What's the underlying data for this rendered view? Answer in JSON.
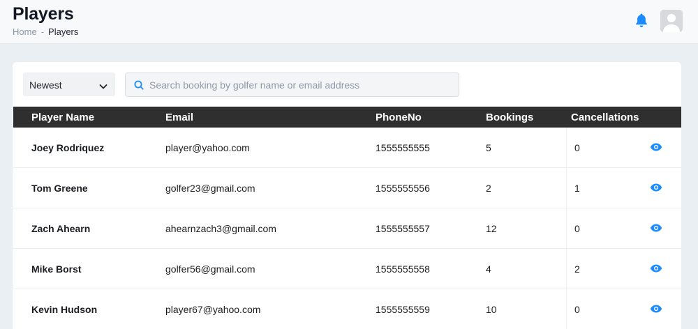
{
  "header": {
    "title": "Players",
    "breadcrumb": {
      "home": "Home",
      "separator": "-",
      "current": "Players"
    },
    "icons": [
      "bell-icon",
      "avatar"
    ]
  },
  "toolbar": {
    "sort_selected": "Newest",
    "search_placeholder": "Search booking by golfer name or email address",
    "search_value": ""
  },
  "table": {
    "columns": [
      "Player Name",
      "Email",
      "PhoneNo",
      "Bookings",
      "Cancellations"
    ],
    "rows": [
      {
        "name": "Joey Rodriquez",
        "email": "player@yahoo.com",
        "phone": "1555555555",
        "bookings": "5",
        "cancellations": "0"
      },
      {
        "name": "Tom Greene",
        "email": "golfer23@gmail.com",
        "phone": "1555555556",
        "bookings": "2",
        "cancellations": "1"
      },
      {
        "name": "Zach Ahearn",
        "email": "ahearnzach3@gmail.com",
        "phone": "1555555557",
        "bookings": "12",
        "cancellations": "0"
      },
      {
        "name": "Mike Borst",
        "email": "golfer56@gmail.com",
        "phone": "1555555558",
        "bookings": "4",
        "cancellations": "2"
      },
      {
        "name": "Kevin Hudson",
        "email": "player67@yahoo.com",
        "phone": "1555555559",
        "bookings": "10",
        "cancellations": "0"
      }
    ],
    "row_action_icon": "eye-icon"
  },
  "colors": {
    "accent": "#1a8cff",
    "header_bg": "#2f2f2f",
    "page_bg": "#e9eff3"
  }
}
